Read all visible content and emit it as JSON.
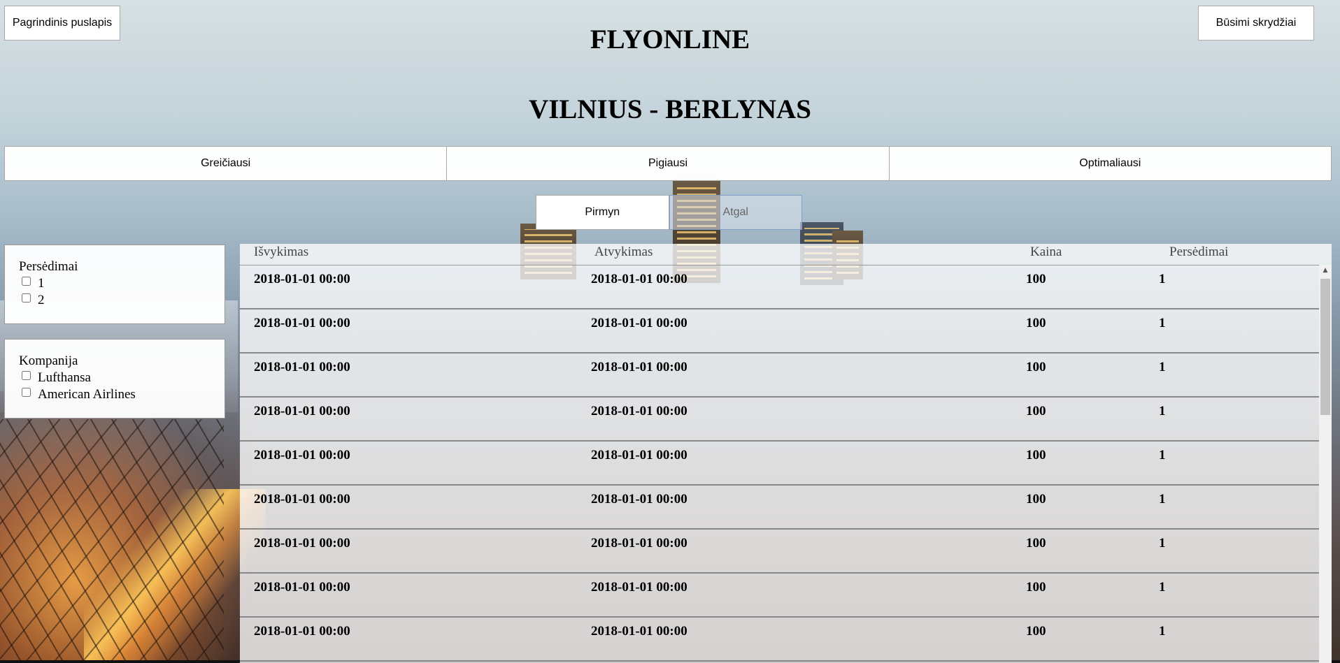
{
  "nav": {
    "home_label": "Pagrindinis puslapis",
    "upcoming_label": "Būsimi skrydžiai"
  },
  "header": {
    "brand": "FLYONLINE",
    "route": "VILNIUS - BERLYNAS"
  },
  "sort_tabs": [
    {
      "label": "Greičiausi"
    },
    {
      "label": "Pigiausi"
    },
    {
      "label": "Optimaliausi"
    }
  ],
  "direction": {
    "forward_label": "Pirmyn",
    "back_label": "Atgal",
    "selected": "Pirmyn"
  },
  "filters": {
    "transfers": {
      "title": "Persėdimai",
      "options": [
        {
          "label": "1",
          "checked": false
        },
        {
          "label": "2",
          "checked": false
        }
      ]
    },
    "company": {
      "title": "Kompanija",
      "options": [
        {
          "label": "Lufthansa",
          "checked": false
        },
        {
          "label": "American Airlines",
          "checked": false
        }
      ]
    }
  },
  "table": {
    "headers": {
      "departure": "Išvykimas",
      "arrival": "Atvykimas",
      "price": "Kaina",
      "transfers": "Persėdimai"
    },
    "rows": [
      {
        "departure": "2018-01-01 00:00",
        "arrival": "2018-01-01 00:00",
        "price": "100",
        "transfers": "1"
      },
      {
        "departure": "2018-01-01 00:00",
        "arrival": "2018-01-01 00:00",
        "price": "100",
        "transfers": "1"
      },
      {
        "departure": "2018-01-01 00:00",
        "arrival": "2018-01-01 00:00",
        "price": "100",
        "transfers": "1"
      },
      {
        "departure": "2018-01-01 00:00",
        "arrival": "2018-01-01 00:00",
        "price": "100",
        "transfers": "1"
      },
      {
        "departure": "2018-01-01 00:00",
        "arrival": "2018-01-01 00:00",
        "price": "100",
        "transfers": "1"
      },
      {
        "departure": "2018-01-01 00:00",
        "arrival": "2018-01-01 00:00",
        "price": "100",
        "transfers": "1"
      },
      {
        "departure": "2018-01-01 00:00",
        "arrival": "2018-01-01 00:00",
        "price": "100",
        "transfers": "1"
      },
      {
        "departure": "2018-01-01 00:00",
        "arrival": "2018-01-01 00:00",
        "price": "100",
        "transfers": "1"
      },
      {
        "departure": "2018-01-01 00:00",
        "arrival": "2018-01-01 00:00",
        "price": "100",
        "transfers": "1"
      }
    ]
  },
  "icons": {
    "scroll_up": "scroll-up-arrow-icon"
  }
}
